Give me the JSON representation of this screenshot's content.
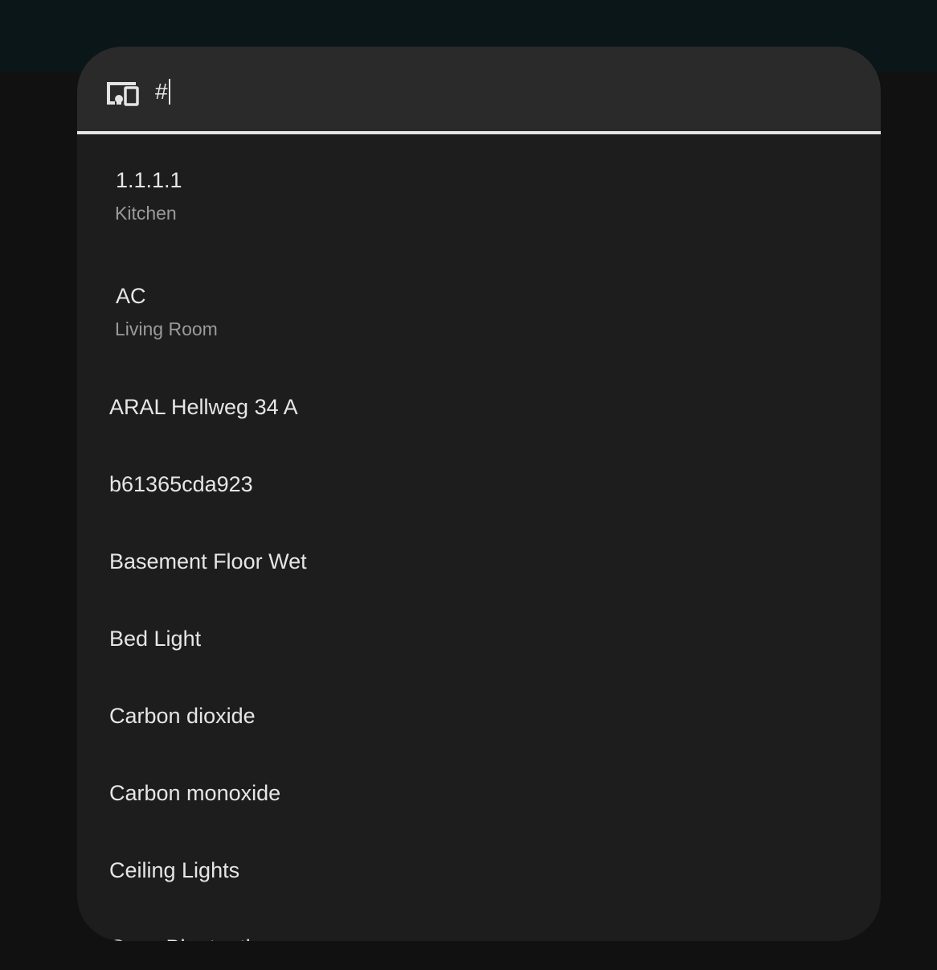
{
  "search": {
    "query": "#",
    "icon": "devices-icon"
  },
  "items": [
    {
      "label": "1.1.1.1",
      "area": "Kitchen"
    },
    {
      "label": "AC",
      "area": "Living Room"
    },
    {
      "label": "ARAL Hellweg 34 A"
    },
    {
      "label": "b61365cda923"
    },
    {
      "label": "Basement Floor Wet"
    },
    {
      "label": "Bed Light"
    },
    {
      "label": "Carbon dioxide"
    },
    {
      "label": "Carbon monoxide"
    },
    {
      "label": "Ceiling Lights"
    },
    {
      "label": "Cave Bluetooth"
    }
  ],
  "colors": {
    "surface": "#1d1d1d",
    "search_bar": "#2a2a2a",
    "primary_text": "#e6e6e6",
    "secondary_text": "#9a9a9a",
    "divider": "#e4e4e4"
  }
}
